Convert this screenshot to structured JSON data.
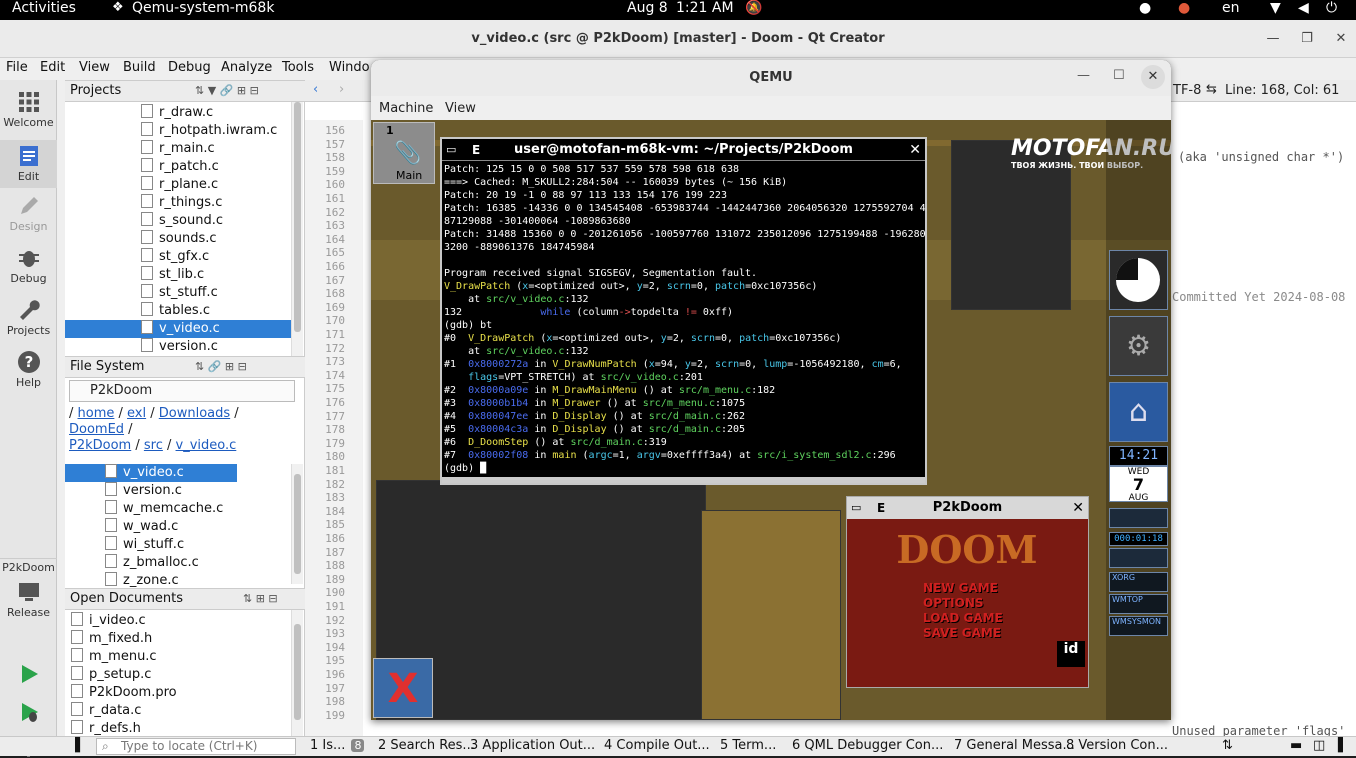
{
  "topbar": {
    "activities": "Activities",
    "app": "Qemu-system-m68k",
    "date": "Aug 8",
    "time": "1:21 AM",
    "lang": "en"
  },
  "qc": {
    "title": "v_video.c (src @ P2kDoom) [master] - Doom - Qt Creator",
    "menus": [
      "File",
      "Edit",
      "View",
      "Build",
      "Debug",
      "Analyze",
      "Tools",
      "Windo"
    ],
    "modes": [
      "Welcome",
      "Edit",
      "Design",
      "Debug",
      "Projects",
      "Help"
    ],
    "kit_label": "P2kDoom",
    "kit_build": "Release",
    "projects_label": "Projects",
    "project_files": [
      "r_draw.c",
      "r_hotpath.iwram.c",
      "r_main.c",
      "r_patch.c",
      "r_plane.c",
      "r_things.c",
      "s_sound.c",
      "sounds.c",
      "st_gfx.c",
      "st_lib.c",
      "st_stuff.c",
      "tables.c",
      "v_video.c",
      "version.c"
    ],
    "filesystem_label": "File System",
    "fs_root": "P2kDoom",
    "breadcrumb1": [
      "home",
      "exl",
      "Downloads",
      "DoomEd"
    ],
    "breadcrumb2": [
      "P2kDoom",
      "src",
      "v_video.c"
    ],
    "fs_files": [
      "v_video.c",
      "version.c",
      "w_memcache.c",
      "w_wad.c",
      "wi_stuff.c",
      "z_bmalloc.c",
      "z_zone.c"
    ],
    "opendocs_label": "Open Documents",
    "open_docs": [
      "i_video.c",
      "m_fixed.h",
      "m_menu.c",
      "p_setup.c",
      "P2kDoom.pro",
      "r_data.c",
      "r_defs.h",
      "v_video.c"
    ],
    "line_numbers": [
      "156",
      "157",
      "158",
      "159",
      "160",
      "161",
      "162",
      "163",
      "164",
      "165",
      "166",
      "167",
      "168",
      "169",
      "170",
      "171",
      "172",
      "173",
      "174",
      "175",
      "176",
      "177",
      "178",
      "179",
      "180",
      "181",
      "182",
      "183",
      "184",
      "185",
      "186",
      "187",
      "188",
      "189",
      "190",
      "191",
      "192",
      "193",
      "194",
      "195",
      "196",
      "197",
      "198",
      "199"
    ],
    "encoding": "TF-8",
    "cursor": "Line: 168, Col: 61",
    "right_snippets": {
      "aka": "(aka 'unsigned char *')",
      "committed": "Committed Yet 2024-08-08",
      "unused": "Unused parameter 'flags'"
    },
    "locate_placeholder": "Type to locate (Ctrl+K)",
    "status_tabs": [
      {
        "n": "1",
        "label": "Is...",
        "badge": "8"
      },
      {
        "n": "2",
        "label": "Search Res..."
      },
      {
        "n": "3",
        "label": "Application Out..."
      },
      {
        "n": "4",
        "label": "Compile Out..."
      },
      {
        "n": "5",
        "label": "Term..."
      },
      {
        "n": "6",
        "label": "QML Debugger Con..."
      },
      {
        "n": "7",
        "label": "General Messa..."
      },
      {
        "n": "8",
        "label": "Version Con..."
      }
    ]
  },
  "qemu": {
    "title": "QEMU",
    "menus": [
      "Machine",
      "View"
    ],
    "workspace": "1",
    "workspace_name": "Main",
    "term_title": "user@motofan-m68k-vm: ~/Projects/P2kDoom",
    "term_lines": [
      [
        [
          "Patch: 125 15 0 0 508 517 537 559 578 598 618 638",
          ""
        ]
      ],
      [
        [
          "===> Cached: M_SKULL2:284:504 -- 160039 bytes (~ 156 KiB)",
          ""
        ]
      ],
      [
        [
          "Patch: 20 19 -1 0 88 97 113 133 154 176 199 223",
          ""
        ]
      ],
      [
        [
          "Patch: 16385 -14336 0 0 134545408 -653983744 -1442447360 2064056320 1275592704 4",
          ""
        ]
      ],
      [
        [
          "87129088 -301400064 -1089863680",
          ""
        ]
      ],
      [
        [
          "Patch: 31488 15360 0 0 -201261056 -100597760 131072 235012096 1275199488 -196280",
          ""
        ]
      ],
      [
        [
          "3200 -889061376 184745984",
          ""
        ]
      ],
      [
        [
          "",
          ""
        ]
      ],
      [
        [
          "Program received signal SIGSEGV, Segmentation fault.",
          ""
        ]
      ],
      [
        [
          "V_DrawPatch",
          "c-y"
        ],
        [
          " (",
          ""
        ],
        [
          "x",
          "c-c"
        ],
        [
          "=<optimized out>, ",
          ""
        ],
        [
          "y",
          "c-c"
        ],
        [
          "=2, ",
          ""
        ],
        [
          "scrn",
          "c-c"
        ],
        [
          "=0, ",
          ""
        ],
        [
          "patch",
          "c-c"
        ],
        [
          "=0xc107356c)",
          ""
        ]
      ],
      [
        [
          "    at ",
          ""
        ],
        [
          "src/v_video.c",
          "c-g"
        ],
        [
          ":132",
          ""
        ]
      ],
      [
        [
          "132             ",
          ""
        ],
        [
          "while",
          "c-b"
        ],
        [
          " (column",
          ""
        ],
        [
          "->",
          "c-r"
        ],
        [
          "topdelta ",
          ""
        ],
        [
          "!=",
          "c-r"
        ],
        [
          " 0xff)",
          ""
        ]
      ],
      [
        [
          "(gdb) bt",
          ""
        ]
      ],
      [
        [
          "#0  ",
          ""
        ],
        [
          "V_DrawPatch",
          "c-y"
        ],
        [
          " (",
          ""
        ],
        [
          "x",
          "c-c"
        ],
        [
          "=<optimized out>, ",
          ""
        ],
        [
          "y",
          "c-c"
        ],
        [
          "=2, ",
          ""
        ],
        [
          "scrn",
          "c-c"
        ],
        [
          "=0, ",
          ""
        ],
        [
          "patch",
          "c-c"
        ],
        [
          "=0xc107356c)",
          ""
        ]
      ],
      [
        [
          "    at ",
          ""
        ],
        [
          "src/v_video.c",
          "c-g"
        ],
        [
          ":132",
          ""
        ]
      ],
      [
        [
          "#1  ",
          ""
        ],
        [
          "0x8000272a",
          "c-b"
        ],
        [
          " in ",
          ""
        ],
        [
          "V_DrawNumPatch",
          "c-y"
        ],
        [
          " (",
          ""
        ],
        [
          "x",
          "c-c"
        ],
        [
          "=94, ",
          ""
        ],
        [
          "y",
          "c-c"
        ],
        [
          "=2, ",
          ""
        ],
        [
          "scrn",
          "c-c"
        ],
        [
          "=0, ",
          ""
        ],
        [
          "lump",
          "c-c"
        ],
        [
          "=-1056492180, ",
          ""
        ],
        [
          "cm",
          "c-c"
        ],
        [
          "=6,",
          ""
        ]
      ],
      [
        [
          "    ",
          ""
        ],
        [
          "flags",
          "c-c"
        ],
        [
          "=VPT_STRETCH) at ",
          ""
        ],
        [
          "src/v_video.c",
          "c-g"
        ],
        [
          ":201",
          ""
        ]
      ],
      [
        [
          "#2  ",
          ""
        ],
        [
          "0x8000a09e",
          "c-b"
        ],
        [
          " in ",
          ""
        ],
        [
          "M_DrawMainMenu",
          "c-y"
        ],
        [
          " () at ",
          ""
        ],
        [
          "src/m_menu.c",
          "c-g"
        ],
        [
          ":182",
          ""
        ]
      ],
      [
        [
          "#3  ",
          ""
        ],
        [
          "0x8000b1b4",
          "c-b"
        ],
        [
          " in ",
          ""
        ],
        [
          "M_Drawer",
          "c-y"
        ],
        [
          " () at ",
          ""
        ],
        [
          "src/m_menu.c",
          "c-g"
        ],
        [
          ":1075",
          ""
        ]
      ],
      [
        [
          "#4  ",
          ""
        ],
        [
          "0x800047ee",
          "c-b"
        ],
        [
          " in ",
          ""
        ],
        [
          "D_Display",
          "c-y"
        ],
        [
          " () at ",
          ""
        ],
        [
          "src/d_main.c",
          "c-g"
        ],
        [
          ":262",
          ""
        ]
      ],
      [
        [
          "#5  ",
          ""
        ],
        [
          "0x80004c3a",
          "c-b"
        ],
        [
          " in ",
          ""
        ],
        [
          "D_Display",
          "c-y"
        ],
        [
          " () at ",
          ""
        ],
        [
          "src/d_main.c",
          "c-g"
        ],
        [
          ":205",
          ""
        ]
      ],
      [
        [
          "#6  ",
          ""
        ],
        [
          "D_DoomStep",
          "c-y"
        ],
        [
          " () at ",
          ""
        ],
        [
          "src/d_main.c",
          "c-g"
        ],
        [
          ":319",
          ""
        ]
      ],
      [
        [
          "#7  ",
          ""
        ],
        [
          "0x80002f08",
          "c-b"
        ],
        [
          " in ",
          ""
        ],
        [
          "main",
          "c-y"
        ],
        [
          " (",
          ""
        ],
        [
          "argc",
          "c-c"
        ],
        [
          "=1, ",
          ""
        ],
        [
          "argv",
          "c-c"
        ],
        [
          "=0xeffff3a4) at ",
          ""
        ],
        [
          "src/i_system_sdl2.c",
          "c-g"
        ],
        [
          ":296",
          ""
        ]
      ],
      [
        [
          "(gdb) ",
          ""
        ]
      ]
    ],
    "doom_title": "P2kDoom",
    "doom_menu": [
      "NEW GAME",
      "OPTIONS",
      "LOAD GAME",
      "SAVE GAME"
    ],
    "logo_text": "MOTOFAN.RU",
    "logo_sub": "ТВОЯ ЖИЗНЬ. ТВОИ ВЫБОР.",
    "clock": "14:21",
    "cal_day": "WED",
    "cal_date": "7",
    "cal_month": "AUG",
    "timer": "000:01:18",
    "dock_labels": [
      "XORG",
      "WMTOP",
      "WMSYSMON"
    ]
  }
}
